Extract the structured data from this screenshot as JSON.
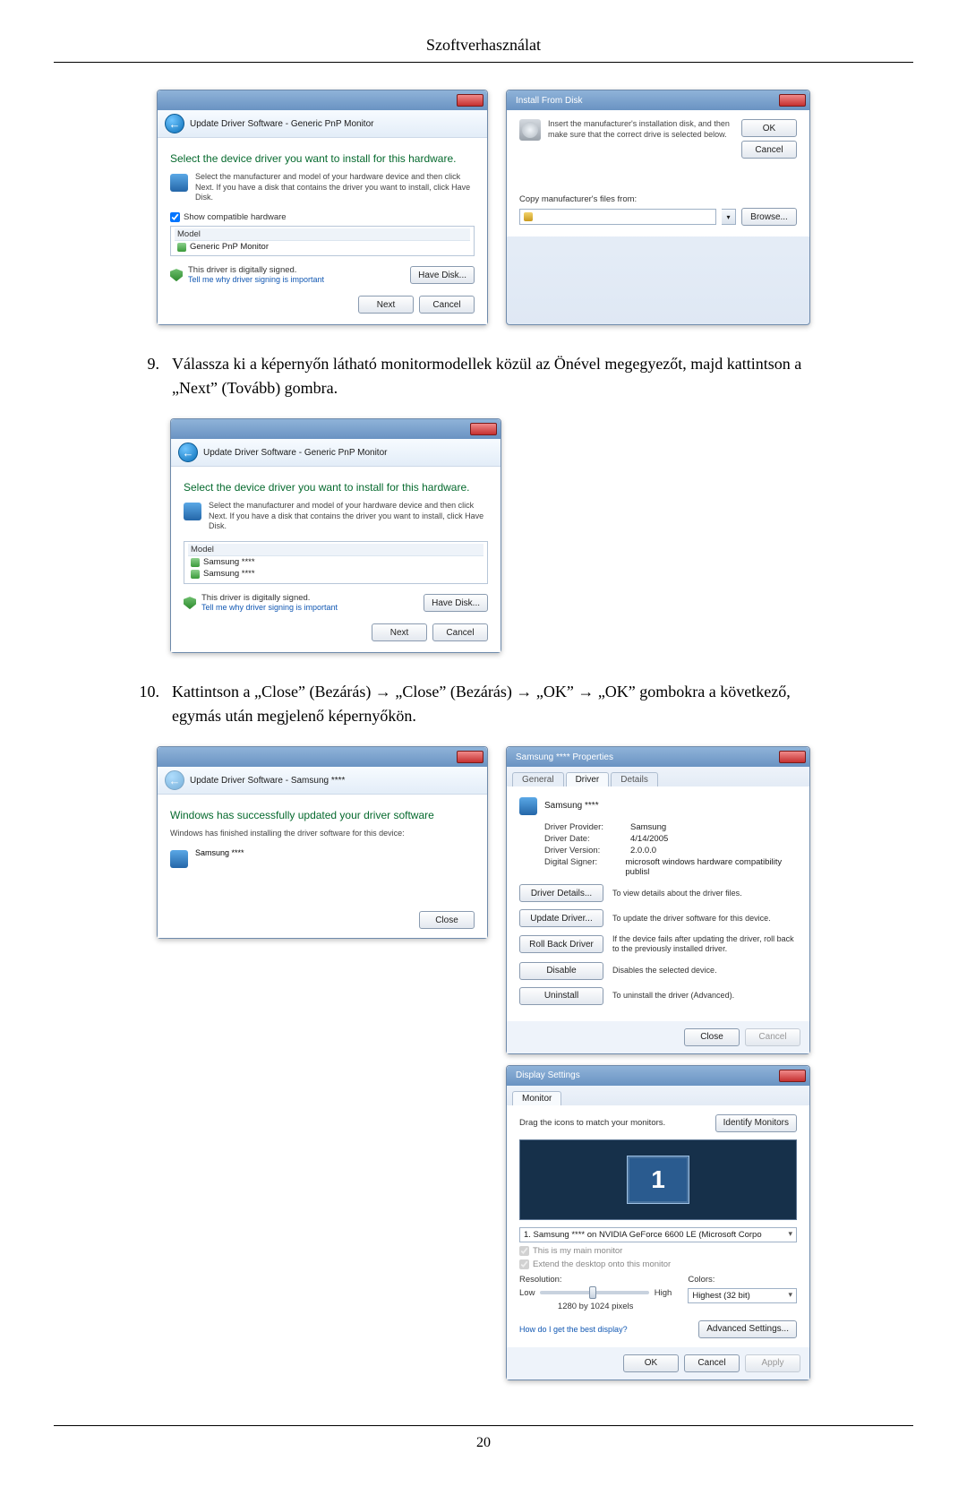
{
  "page": {
    "header": "Szoftverhasználat",
    "number": "20"
  },
  "steps": {
    "s9": {
      "num": "9.",
      "text": "Válassza ki a képernyőn látható monitormodellek közül az Önével megegyezőt, majd kattintson a „Next” (Tovább) gombra."
    },
    "s10": {
      "num": "10.",
      "text": "Kattintson a „Close” (Bezárás) → „Close” (Bezárás) → „OK” → „OK” gombokra a következő, egymás után megjelenő képernyőkön."
    }
  },
  "dlg_update1": {
    "breadcrumb": "Update Driver Software - Generic PnP Monitor",
    "title": "Select the device driver you want to install for this hardware.",
    "hint": "Select the manufacturer and model of your hardware device and then click Next. If you have a disk that contains the driver you want to install, click Have Disk.",
    "chk_compat": "Show compatible hardware",
    "list_header": "Model",
    "list_item": "Generic PnP Monitor",
    "signed": "This driver is digitally signed.",
    "signed_link": "Tell me why driver signing is important",
    "have_disk": "Have Disk...",
    "next": "Next",
    "cancel": "Cancel"
  },
  "dlg_install_disk": {
    "title": "Install From Disk",
    "hint": "Insert the manufacturer's installation disk, and then make sure that the correct drive is selected below.",
    "ok": "OK",
    "cancel": "Cancel",
    "copy_label": "Copy manufacturer's files from:",
    "browse": "Browse..."
  },
  "dlg_update2": {
    "breadcrumb": "Update Driver Software - Generic PnP Monitor",
    "title": "Select the device driver you want to install for this hardware.",
    "hint": "Select the manufacturer and model of your hardware device and then click Next. If you have a disk that contains the driver you want to install, click Have Disk.",
    "list_header": "Model",
    "list_item1": "Samsung ****",
    "list_item2": "Samsung ****",
    "signed": "This driver is digitally signed.",
    "signed_link": "Tell me why driver signing is important",
    "have_disk": "Have Disk...",
    "next": "Next",
    "cancel": "Cancel"
  },
  "dlg_update_done": {
    "breadcrumb": "Update Driver Software - Samsung ****",
    "title": "Windows has successfully updated your driver software",
    "sub": "Windows has finished installing the driver software for this device:",
    "device": "Samsung ****",
    "close": "Close"
  },
  "dlg_props": {
    "title": "Samsung **** Properties",
    "tab_general": "General",
    "tab_driver": "Driver",
    "tab_details": "Details",
    "device": "Samsung ****",
    "k_provider": "Driver Provider:",
    "v_provider": "Samsung",
    "k_date": "Driver Date:",
    "v_date": "4/14/2005",
    "k_version": "Driver Version:",
    "v_version": "2.0.0.0",
    "k_signer": "Digital Signer:",
    "v_signer": "microsoft windows hardware compatibility publisl",
    "b_details": "Driver Details...",
    "d_details": "To view details about the driver files.",
    "b_update": "Update Driver...",
    "d_update": "To update the driver software for this device.",
    "b_rollback": "Roll Back Driver",
    "d_rollback": "If the device fails after updating the driver, roll back to the previously installed driver.",
    "b_disable": "Disable",
    "d_disable": "Disables the selected device.",
    "b_uninstall": "Uninstall",
    "d_uninstall": "To uninstall the driver (Advanced).",
    "close": "Close",
    "cancel": "Cancel"
  },
  "dlg_display": {
    "title": "Display Settings",
    "tab": "Monitor",
    "drag": "Drag the icons to match your monitors.",
    "identify": "Identify Monitors",
    "mon_num": "1",
    "dd_value": "1. Samsung **** on NVIDIA GeForce 6600 LE (Microsoft Corpo",
    "chk_main": "This is my main monitor",
    "chk_extend": "Extend the desktop onto this monitor",
    "res_label": "Resolution:",
    "low": "Low",
    "high": "High",
    "res_value": "1280 by 1024 pixels",
    "col_label": "Colors:",
    "col_value": "Highest (32 bit)",
    "help_link": "How do I get the best display?",
    "adv": "Advanced Settings...",
    "ok": "OK",
    "cancel": "Cancel",
    "apply": "Apply"
  }
}
